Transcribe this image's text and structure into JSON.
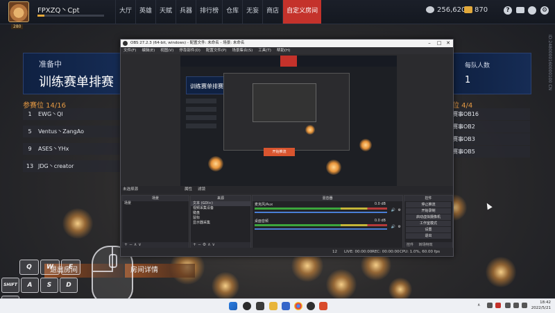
{
  "player": {
    "name": "FPXZQ丶Cpt",
    "level": "280",
    "xp_fraction": 0.1
  },
  "nav": {
    "items": [
      "大厅",
      "英雄",
      "天赋",
      "兵器",
      "排行榜",
      "仓库",
      "无妄",
      "商店",
      "自定义房间"
    ],
    "active_index": 8
  },
  "currency": {
    "coins": "256,620",
    "gold": "870"
  },
  "top_icons": [
    "help-icon",
    "mail-icon",
    "friends-icon",
    "settings-icon"
  ],
  "account_id": "ID:2480000160000100 CN",
  "room": {
    "status": "准备中",
    "name": "训练赛单排赛",
    "team_count_label": "每队人数",
    "team_count_value": "1"
  },
  "participants": {
    "title": "参赛位 14/16",
    "rows": [
      {
        "num": "1",
        "name": "EWG丶Ql"
      },
      {
        "num": "5",
        "name": "Ventus丶ZangAo"
      },
      {
        "num": "9",
        "name": "ASES丶YHx"
      },
      {
        "num": "13",
        "name": "JDG丶creator"
      }
    ]
  },
  "observers": {
    "title": "位 4/4",
    "rows": [
      "赛事OB16",
      "赛事OB2",
      "赛事OB3",
      "赛事OB5"
    ]
  },
  "buttons": {
    "exit_room": "退出房间",
    "room_details": "房间详情"
  },
  "keys": {
    "q": "Q",
    "w": "W",
    "e": "E",
    "a": "A",
    "s": "S",
    "d": "D",
    "shift": "SHIFT",
    "ctrl": "CTRL"
  },
  "obs": {
    "title": "OBS 27.2.3 (64-bit, windows) - 配置文件: 未命名 - 场景: 未命名",
    "menu": [
      "文件(F)",
      "编辑(E)",
      "视图(V)",
      "停靠部件(D)",
      "配置文件(P)",
      "场景集合(S)",
      "工具(T)",
      "帮助(H)"
    ],
    "scene_bar_label": "未选择源",
    "scene_bar_tabs": [
      "属性",
      "滤镜"
    ],
    "scenes_header": "场景",
    "scenes": [
      "场景"
    ],
    "sources_header": "来源",
    "sources": [
      "文本 (GDI+)",
      "视频采集设备",
      "键盘",
      "鼠标",
      "显示器采集"
    ],
    "mixer_header": "混音器",
    "mixer": [
      {
        "name": "麦克风/Aux",
        "value": "0.0 dB"
      },
      {
        "name": "桌面音频",
        "value": "0.0 dB"
      }
    ],
    "controls_header": "控件",
    "controls": [
      "停止推流",
      "开始录制",
      "启动虚拟摄像机",
      "工作室模式",
      "设置",
      "退出"
    ],
    "controls_bottom": [
      "控件",
      "转场特效"
    ],
    "status": {
      "live": "LIVE: 00:00:00",
      "rec": "REC: 00:00:00",
      "cpu": "CPU: 1.0%, 60.00 fps",
      "dropped": "12"
    },
    "preview_orange_button": "开始推流",
    "preview_room_name": "训练赛单排赛"
  },
  "taskbar": {
    "time": "18:42",
    "date": "2022/5/21"
  }
}
